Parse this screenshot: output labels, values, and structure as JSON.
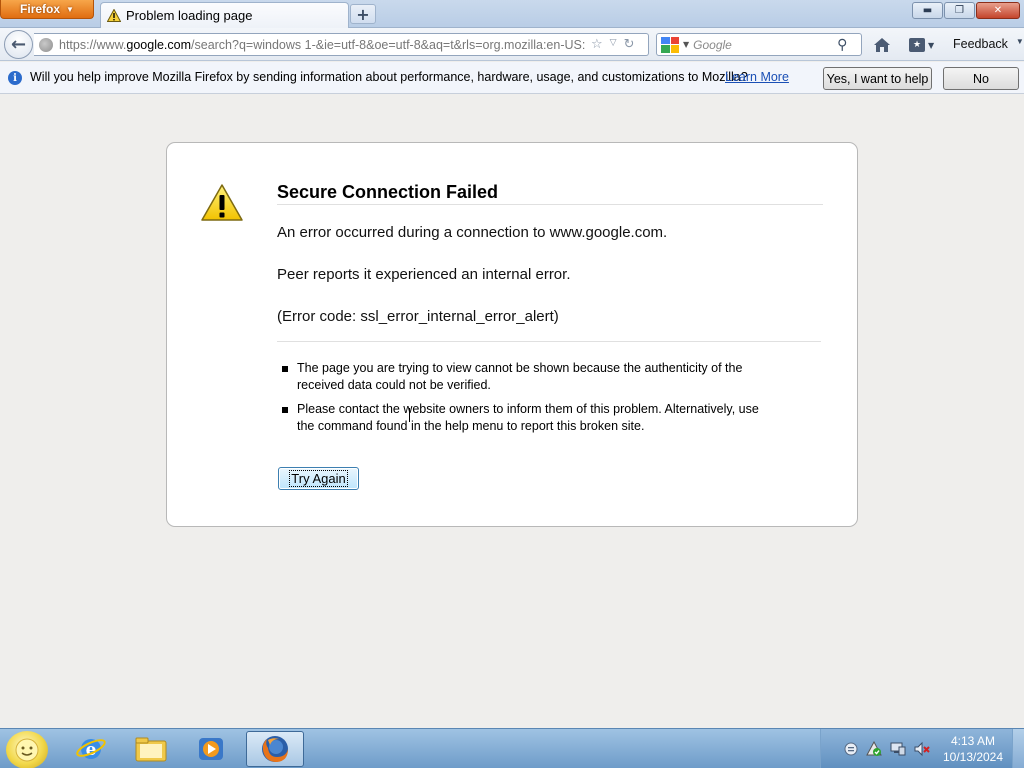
{
  "browser": {
    "menu_button": "Firefox",
    "tab_title": "Problem loading page",
    "new_tab": "+",
    "window_controls": {
      "minimize": "▬",
      "restore": "❐",
      "close": "✕"
    }
  },
  "navbar": {
    "url_prefix": "https://www.",
    "url_domain": "google.com",
    "url_rest": "/search?q=windows 1-&ie=utf-8&oe=utf-8&aq=t&rls=org.mozilla:en-US:",
    "search_placeholder": "Google",
    "feedback_label": "Feedback"
  },
  "notification": {
    "message": "Will you help improve Mozilla Firefox by sending information about performance, hardware, usage, and customizations to Mozilla?",
    "learn_more": "Learn More",
    "yes_button": "Yes, I want to help",
    "no_button": "No"
  },
  "error_page": {
    "title": "Secure Connection Failed",
    "paragraphs": [
      "An error occurred during a connection to www.google.com.",
      "Peer reports it experienced an internal error.",
      "(Error code: ssl_error_internal_error_alert)"
    ],
    "bullets": [
      "The page you are trying to view cannot be shown because the authenticity of the received data could not be verified.",
      "Please contact the website owners to inform them of this problem. Alternatively, use the command found in the help menu to report this broken site."
    ],
    "try_again": "Try Again"
  },
  "taskbar": {
    "pinned": [
      "internet-explorer-icon",
      "folder-icon",
      "media-player-icon",
      "firefox-icon"
    ],
    "active_app": "firefox-icon",
    "clock_time": "4:13 AM",
    "clock_date": "10/13/2024"
  },
  "colors": {
    "firefox_orange": "#e06d10",
    "link_blue": "#1a4fb5",
    "taskbar_blue": "#6e9cc9",
    "page_background": "#efeeec"
  }
}
